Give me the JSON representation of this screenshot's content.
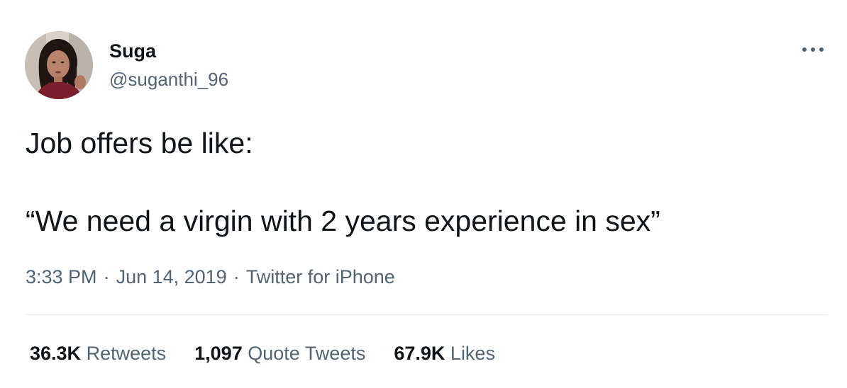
{
  "author": {
    "display_name": "Suga",
    "handle": "@suganthi_96"
  },
  "tweet": {
    "line1": "Job offers be like:",
    "line2": "“We need a virgin with 2 years experience in sex”"
  },
  "meta": {
    "time": "3:33 PM",
    "date": "Jun 14, 2019",
    "source": "Twitter for iPhone",
    "separator": "·"
  },
  "stats": {
    "retweets": {
      "count": "36.3K",
      "label": "Retweets"
    },
    "quotes": {
      "count": "1,097",
      "label": "Quote Tweets"
    },
    "likes": {
      "count": "67.9K",
      "label": "Likes"
    }
  },
  "icons": {
    "more": "more-horizontal-icon"
  },
  "colors": {
    "text_primary": "#0f1419",
    "text_secondary": "#536471",
    "divider": "#e6ecf0",
    "background": "#ffffff"
  }
}
